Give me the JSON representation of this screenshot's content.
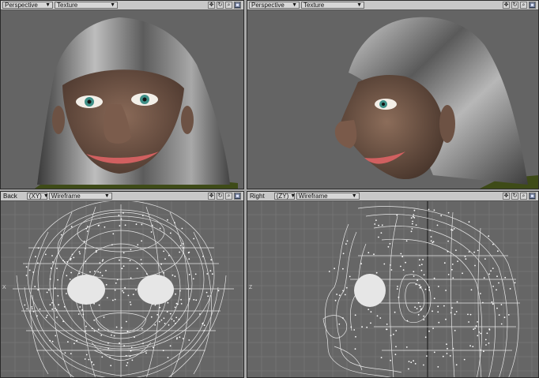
{
  "viewports": {
    "top_left": {
      "view": "Perspective",
      "mode": "Texture"
    },
    "top_right": {
      "view": "Perspective",
      "mode": "Texture"
    },
    "bottom_left": {
      "view": "Back",
      "axis": "(XY)",
      "mode": "Wireframe"
    },
    "bottom_right": {
      "view": "Right",
      "axis": "(ZY)",
      "mode": "Wireframe"
    }
  },
  "toolbar_icons": [
    "move-view-icon",
    "rotate-view-icon",
    "zoom-view-icon",
    "maximize-view-icon"
  ],
  "edge_labels": {
    "back_left": "X",
    "right_left": "Z"
  },
  "colors": {
    "viewport_bg": "#646464",
    "header_bg": "#c8c8c8",
    "grid": "#7e7e7e",
    "wire": "#e8e8e8"
  }
}
